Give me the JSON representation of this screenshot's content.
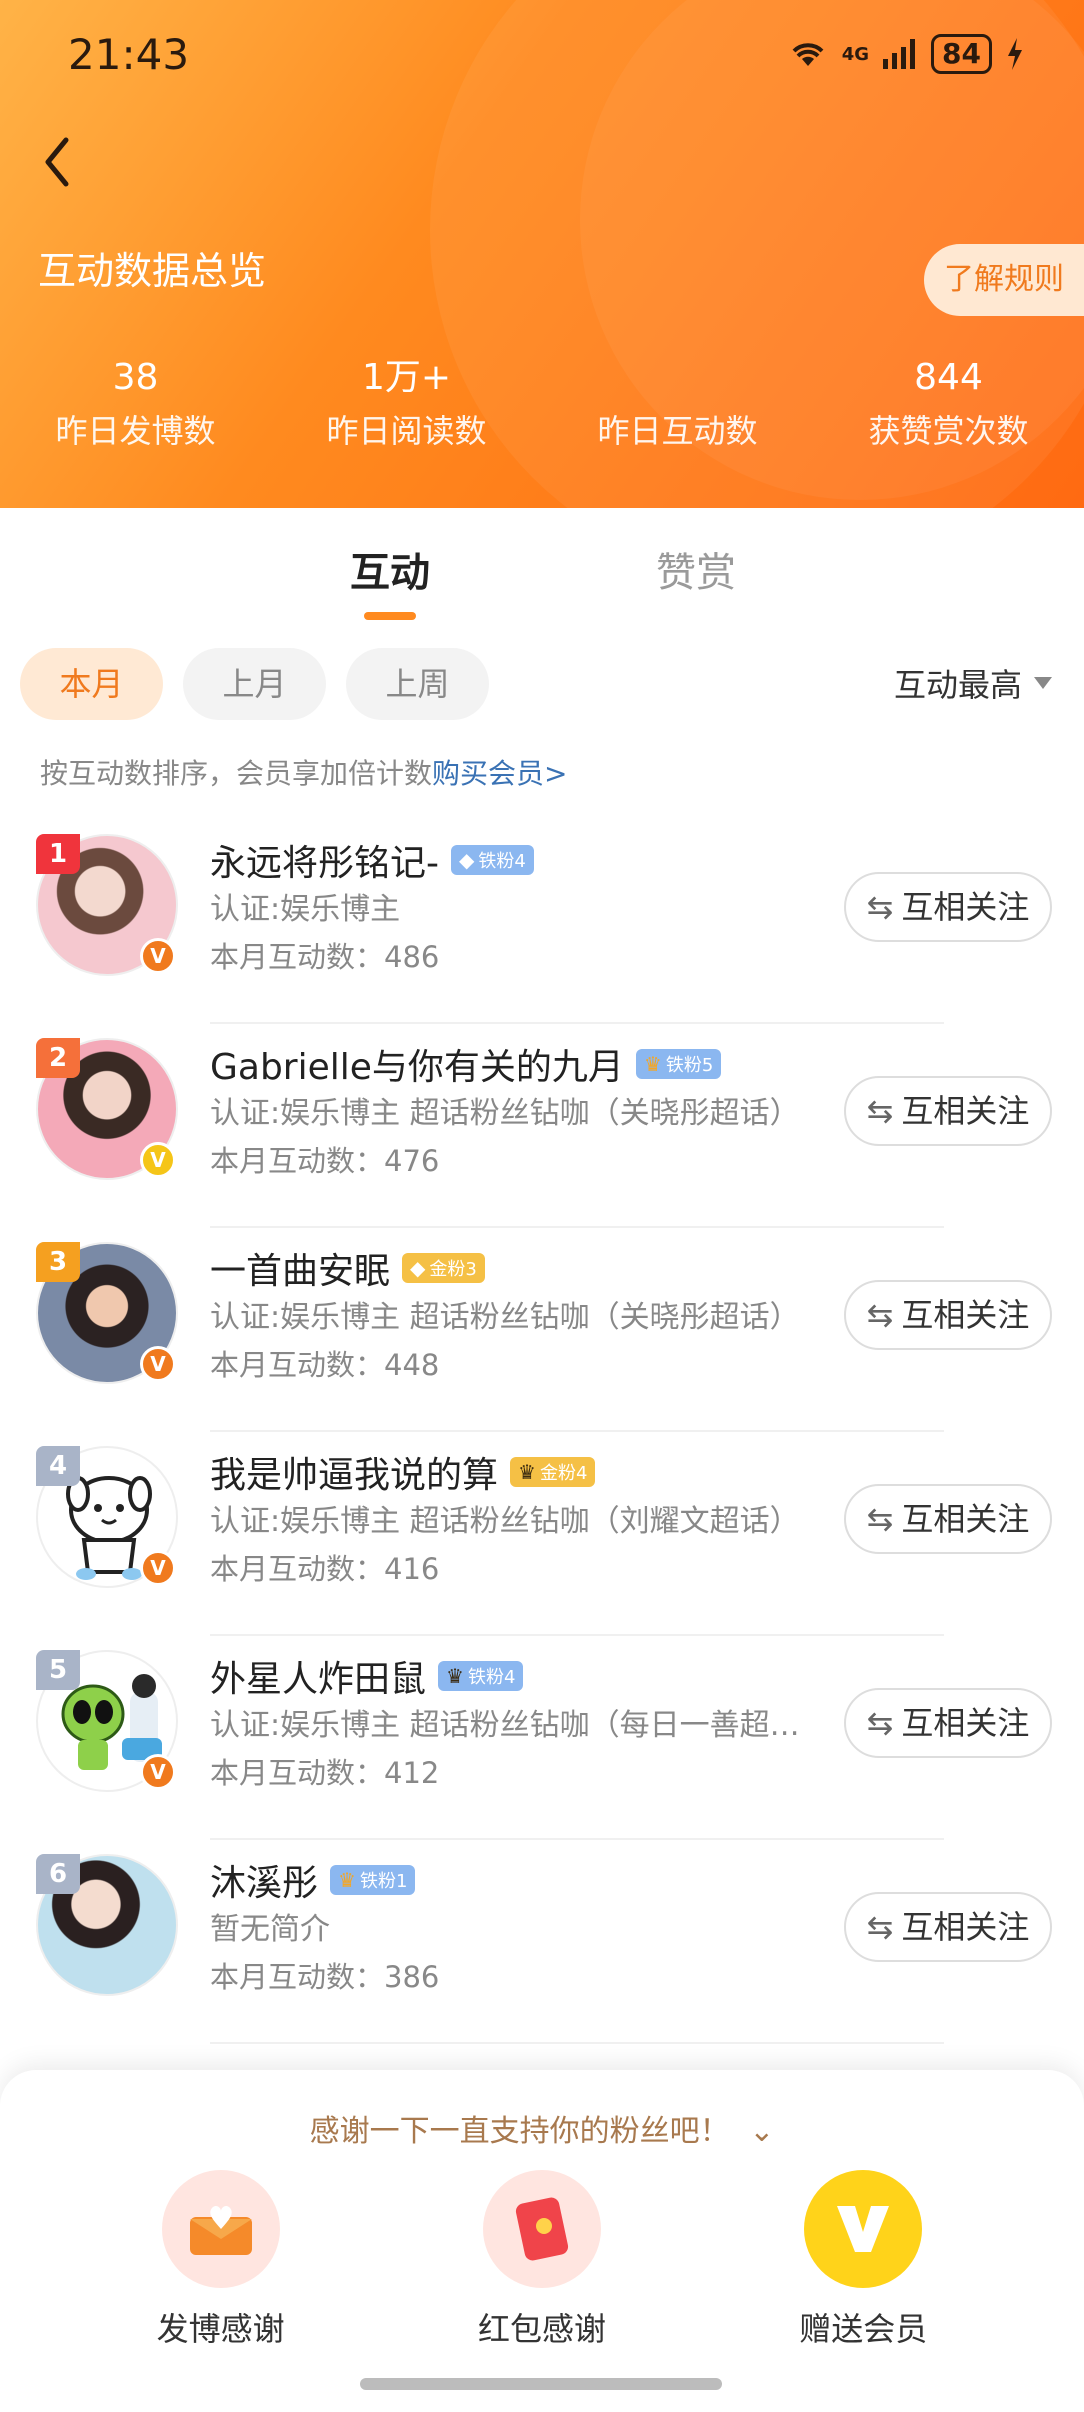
{
  "status": {
    "time": "21:43",
    "network": "4G",
    "battery": "84"
  },
  "header": {
    "title": "互动数据总览",
    "rules_label": "了解规则",
    "stats": [
      {
        "value": "38",
        "label": "昨日发博数"
      },
      {
        "value": "1万+",
        "label": "昨日阅读数"
      },
      {
        "value": "",
        "label": "昨日互动数"
      },
      {
        "value": "844",
        "label": "获赞赏次数"
      }
    ]
  },
  "tabs": {
    "active": "互动",
    "inactive": "赞赏"
  },
  "filters": {
    "chips": [
      "本月",
      "上月",
      "上周"
    ],
    "sort_label": "互动最高"
  },
  "hint": {
    "text": "按互动数排序，会员享加倍计数",
    "link": "购买会员>"
  },
  "follow_label": "互相关注",
  "list": [
    {
      "rank": "1",
      "name": "永远将彤铭记-",
      "badge": "铁粉4",
      "cert": "认证:娱乐博主",
      "count": "本月互动数：486"
    },
    {
      "rank": "2",
      "name": "Gabrielle与你有关的九月",
      "badge": "铁粉5",
      "cert": "认证:娱乐博主 超话粉丝钻咖（关晓彤超话）",
      "count": "本月互动数：476"
    },
    {
      "rank": "3",
      "name": "一首曲安眠",
      "badge": "金粉3",
      "cert": "认证:娱乐博主 超话粉丝钻咖（关晓彤超话）",
      "count": "本月互动数：448"
    },
    {
      "rank": "4",
      "name": "我是帅逼我说的算",
      "badge": "金粉4",
      "cert": "认证:娱乐博主 超话粉丝钻咖（刘耀文超话）",
      "count": "本月互动数：416"
    },
    {
      "rank": "5",
      "name": "外星人炸田鼠",
      "badge": "铁粉4",
      "cert": "认证:娱乐博主 超话粉丝钻咖（每日一善超…",
      "count": "本月互动数：412"
    },
    {
      "rank": "6",
      "name": "沐溪彤",
      "badge": "铁粉1",
      "cert": "暂无简介",
      "count": "本月互动数：386"
    }
  ],
  "bottom": {
    "thanks_text": "感谢一下一直支持你的粉丝吧！",
    "actions": [
      "发博感谢",
      "红包感谢",
      "赠送会员"
    ]
  },
  "colors": {
    "accent": "#ff8a1f",
    "link": "#3a72b4"
  }
}
